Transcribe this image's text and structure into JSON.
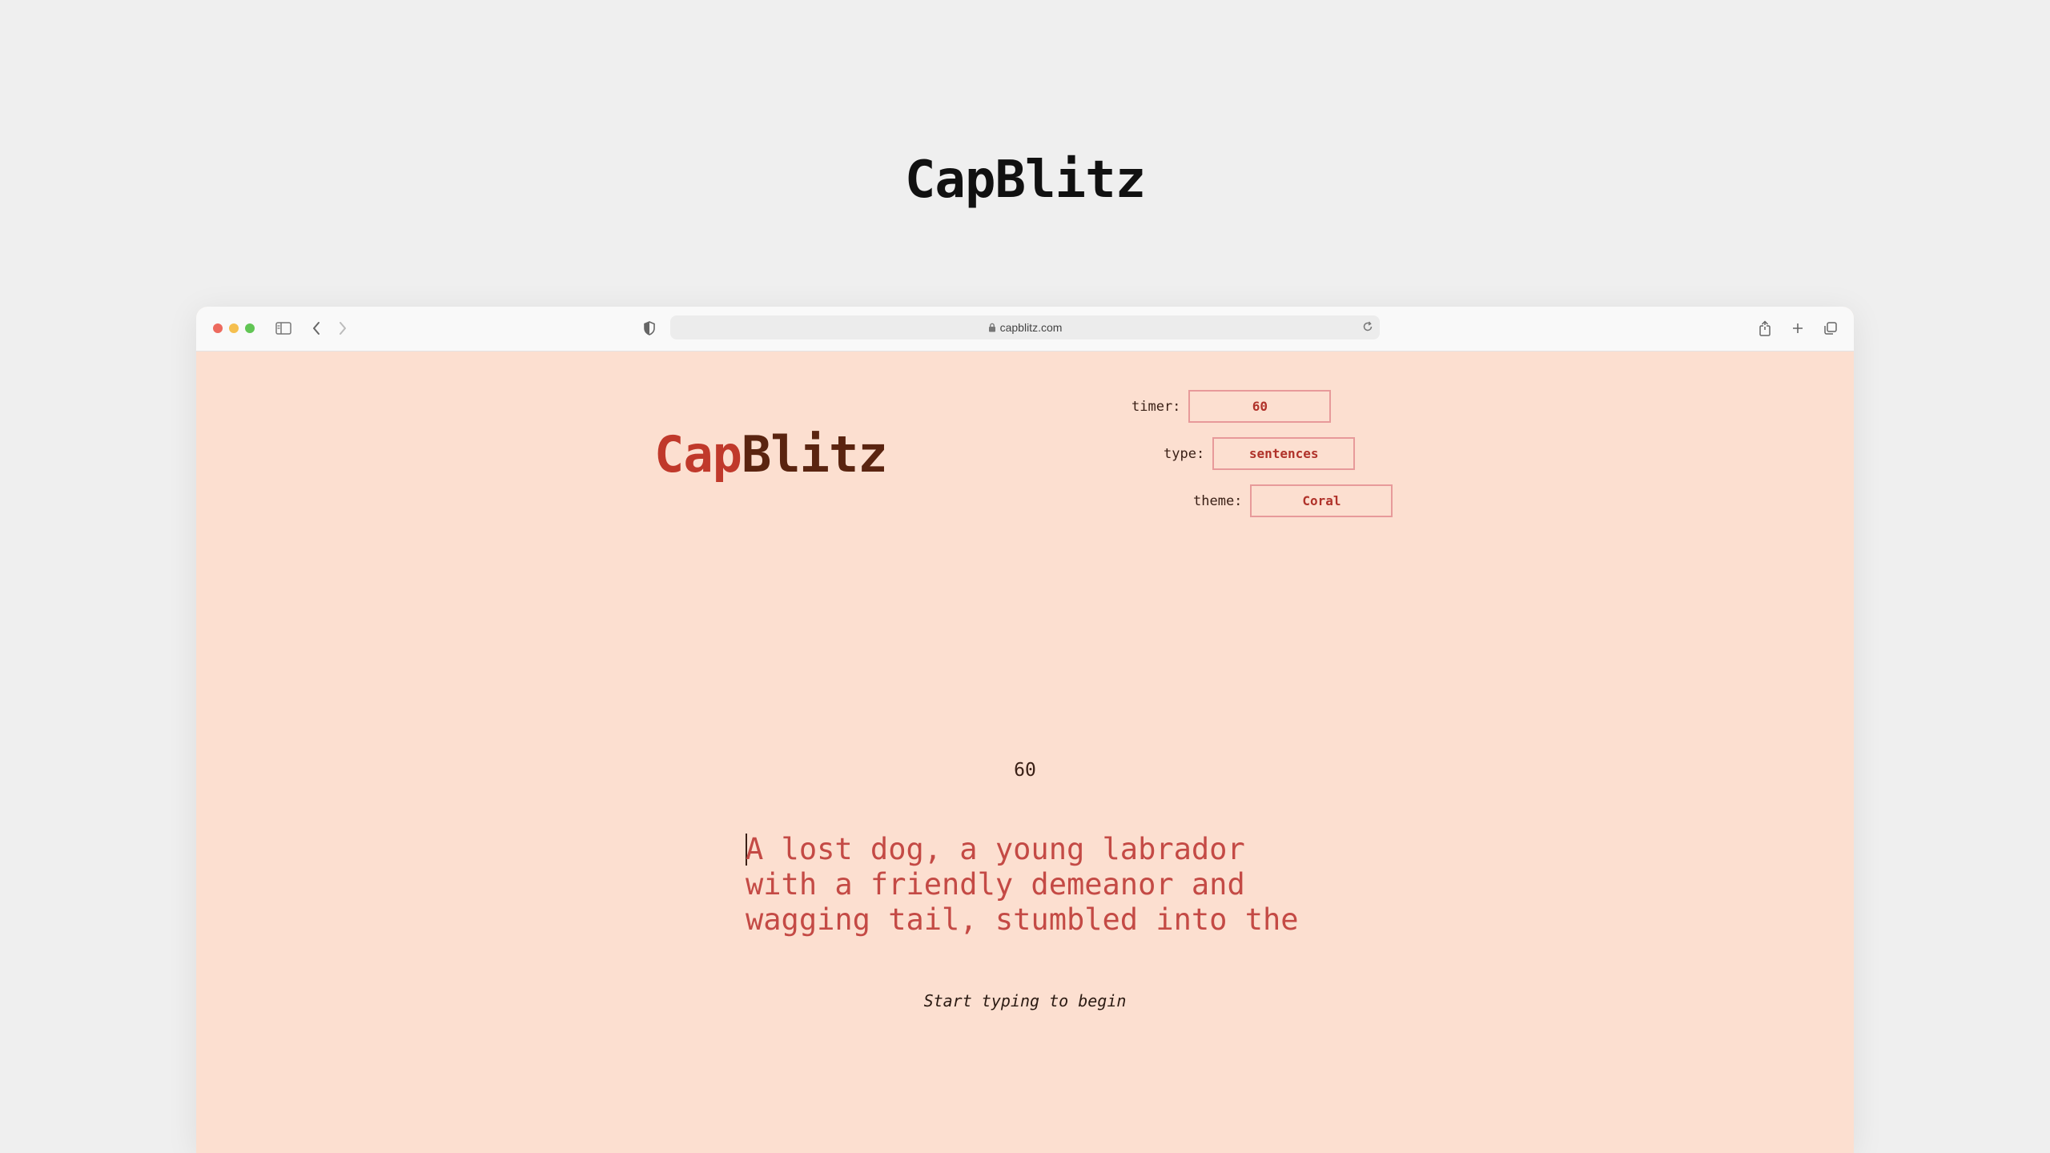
{
  "hero": {
    "title": "CapBlitz"
  },
  "browser": {
    "url": "capblitz.com",
    "traffic_lights": [
      "#ed6a5e",
      "#f5bf4f",
      "#61c554"
    ]
  },
  "app": {
    "logo_part1": "Cap",
    "logo_part2": "Blitz",
    "colors": {
      "background": "#fcdfd0",
      "accent": "#c0392b",
      "dark": "#5a2410",
      "border": "#e79a9a"
    },
    "settings": {
      "timer": {
        "label": "timer:",
        "value": "60"
      },
      "type": {
        "label": "type:",
        "value": "sentences"
      },
      "theme": {
        "label": "theme:",
        "value": "Coral"
      }
    },
    "countdown": "60",
    "text_lines": [
      "A lost dog, a young labrador",
      "with a friendly demeanor and",
      "wagging tail, stumbled into the"
    ],
    "text_first_char": "A",
    "hint": "Start typing to begin"
  }
}
